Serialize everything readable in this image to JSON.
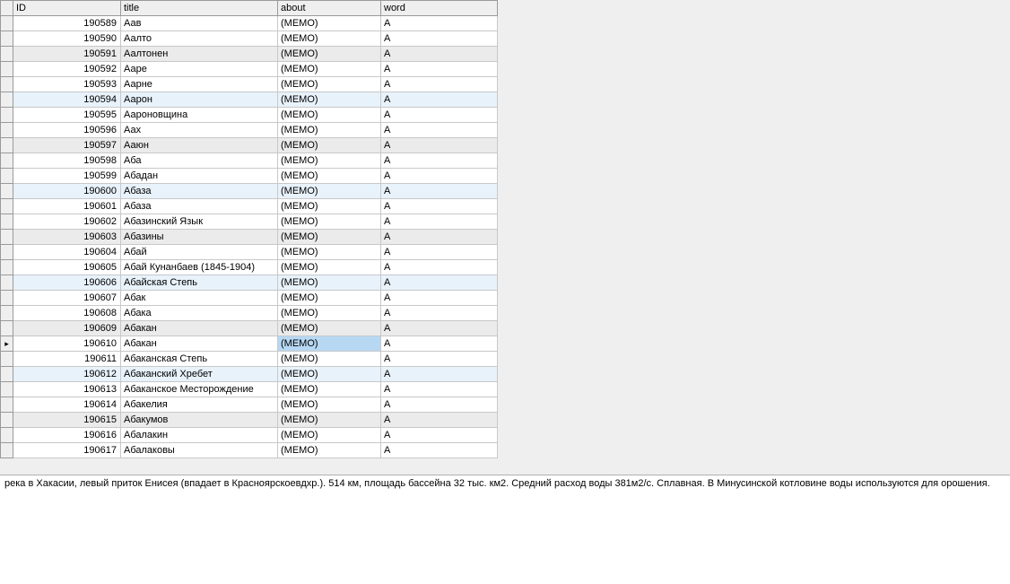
{
  "columns": {
    "id": "ID",
    "title": "title",
    "about": "about",
    "word": "word"
  },
  "rows": [
    {
      "id": "190589",
      "title": "Аав",
      "about": "(MEMO)",
      "word": "А",
      "style": "",
      "current": false,
      "sel": false
    },
    {
      "id": "190590",
      "title": "Аалто",
      "about": "(MEMO)",
      "word": "А",
      "style": "",
      "current": false,
      "sel": false
    },
    {
      "id": "190591",
      "title": "Аалтонен",
      "about": "(MEMO)",
      "word": "А",
      "style": "shaded",
      "current": false,
      "sel": false
    },
    {
      "id": "190592",
      "title": "Ааре",
      "about": "(MEMO)",
      "word": "А",
      "style": "",
      "current": false,
      "sel": false
    },
    {
      "id": "190593",
      "title": "Аарне",
      "about": "(MEMO)",
      "word": "А",
      "style": "",
      "current": false,
      "sel": false
    },
    {
      "id": "190594",
      "title": "Аарон",
      "about": "(MEMO)",
      "word": "А",
      "style": "blue",
      "current": false,
      "sel": false
    },
    {
      "id": "190595",
      "title": "Аароновщина",
      "about": "(MEMO)",
      "word": "А",
      "style": "",
      "current": false,
      "sel": false
    },
    {
      "id": "190596",
      "title": "Аах",
      "about": "(MEMO)",
      "word": "А",
      "style": "",
      "current": false,
      "sel": false
    },
    {
      "id": "190597",
      "title": "Ааюн",
      "about": "(MEMO)",
      "word": "А",
      "style": "shaded",
      "current": false,
      "sel": false
    },
    {
      "id": "190598",
      "title": "Аба",
      "about": "(MEMO)",
      "word": "А",
      "style": "",
      "current": false,
      "sel": false
    },
    {
      "id": "190599",
      "title": "Абадан",
      "about": "(MEMO)",
      "word": "А",
      "style": "",
      "current": false,
      "sel": false
    },
    {
      "id": "190600",
      "title": "Абаза",
      "about": "(MEMO)",
      "word": "А",
      "style": "blue",
      "current": false,
      "sel": false
    },
    {
      "id": "190601",
      "title": "Абаза",
      "about": "(MEMO)",
      "word": "А",
      "style": "",
      "current": false,
      "sel": false
    },
    {
      "id": "190602",
      "title": "Абазинский Язык",
      "about": "(MEMO)",
      "word": "А",
      "style": "",
      "current": false,
      "sel": false
    },
    {
      "id": "190603",
      "title": "Абазины",
      "about": "(MEMO)",
      "word": "А",
      "style": "shaded",
      "current": false,
      "sel": false
    },
    {
      "id": "190604",
      "title": "Абай",
      "about": "(MEMO)",
      "word": "А",
      "style": "",
      "current": false,
      "sel": false
    },
    {
      "id": "190605",
      "title": "Абай Кунанбаев (1845-1904)",
      "about": "(MEMO)",
      "word": "А",
      "style": "",
      "current": false,
      "sel": false
    },
    {
      "id": "190606",
      "title": "Абайская Степь",
      "about": "(MEMO)",
      "word": "А",
      "style": "blue",
      "current": false,
      "sel": false
    },
    {
      "id": "190607",
      "title": "Абак",
      "about": "(MEMO)",
      "word": "А",
      "style": "",
      "current": false,
      "sel": false
    },
    {
      "id": "190608",
      "title": "Абака",
      "about": "(MEMO)",
      "word": "А",
      "style": "",
      "current": false,
      "sel": false
    },
    {
      "id": "190609",
      "title": "Абакан",
      "about": "(MEMO)",
      "word": "А",
      "style": "shaded",
      "current": false,
      "sel": false
    },
    {
      "id": "190610",
      "title": "Абакан",
      "about": "(MEMO)",
      "word": "А",
      "style": "",
      "current": true,
      "sel": true
    },
    {
      "id": "190611",
      "title": "Абаканская Степь",
      "about": "(MEMO)",
      "word": "А",
      "style": "",
      "current": false,
      "sel": false
    },
    {
      "id": "190612",
      "title": "Абаканский Хребет",
      "about": "(MEMO)",
      "word": "А",
      "style": "blue",
      "current": false,
      "sel": false
    },
    {
      "id": "190613",
      "title": "Абаканское Месторождение",
      "about": "(MEMO)",
      "word": "А",
      "style": "",
      "current": false,
      "sel": false
    },
    {
      "id": "190614",
      "title": "Абакелия",
      "about": "(MEMO)",
      "word": "А",
      "style": "",
      "current": false,
      "sel": false
    },
    {
      "id": "190615",
      "title": "Абакумов",
      "about": "(MEMO)",
      "word": "А",
      "style": "shaded",
      "current": false,
      "sel": false
    },
    {
      "id": "190616",
      "title": "Абалакин",
      "about": "(MEMO)",
      "word": "А",
      "style": "",
      "current": false,
      "sel": false
    },
    {
      "id": "190617",
      "title": "Абалаковы",
      "about": "(MEMO)",
      "word": "А",
      "style": "",
      "current": false,
      "sel": false
    }
  ],
  "detail_text": "река в Хакасии, левый приток Енисея (впадает в Красноярскоевдхр.). 514 км, площадь бассейна 32 тыс. км2. Средний расход воды 381м2/с. Сплавная. В Минусинской котловине воды используются для орошения."
}
